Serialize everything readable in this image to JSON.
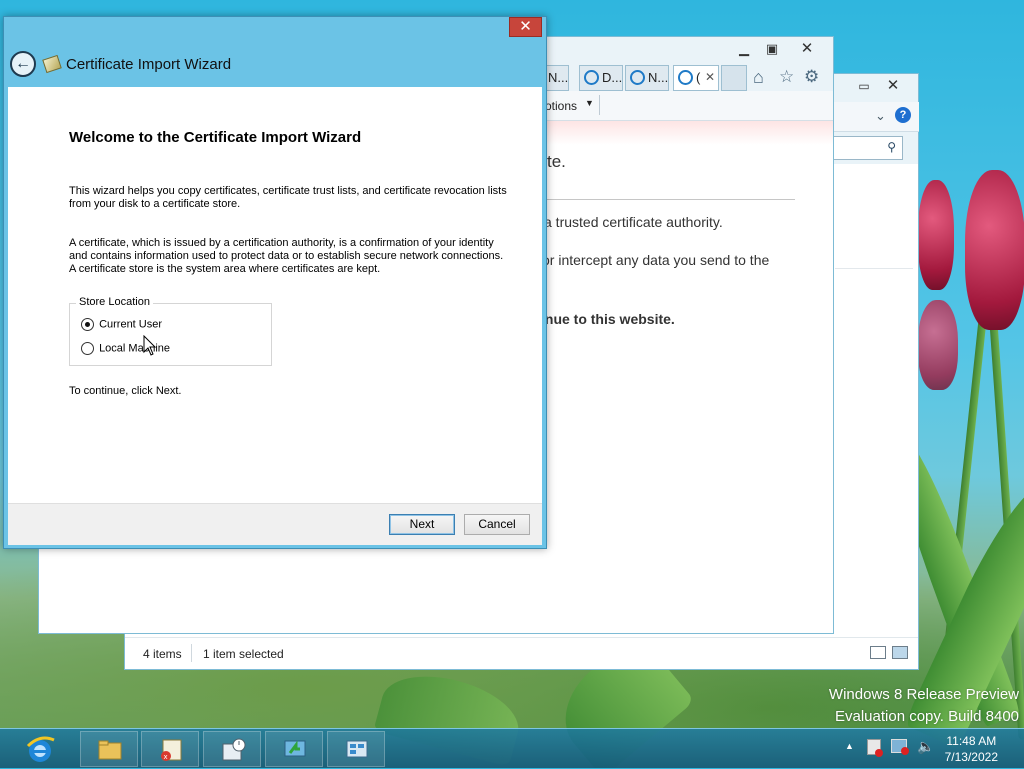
{
  "explorer": {
    "status_items": "4 items",
    "status_selected": "1 item selected"
  },
  "ie": {
    "tabs": [
      {
        "label": "N..."
      },
      {
        "label": "D..."
      },
      {
        "label": "N..."
      },
      {
        "label": "("
      }
    ],
    "active_tab_close": "✕",
    "tools_label": "otions",
    "page": {
      "line1": "te.",
      "line2": "a trusted certificate authority.",
      "line3": "or intercept any data you send to the",
      "line4": "inue to this website."
    }
  },
  "wizard": {
    "title": "Certificate Import Wizard",
    "close_label": "✕",
    "back_label": "←",
    "heading": "Welcome to the Certificate Import Wizard",
    "para1": "This wizard helps you copy certificates, certificate trust lists, and certificate revocation lists from your disk to a certificate store.",
    "para2": "A certificate, which is issued by a certification authority, is a confirmation of your identity and contains information used to protect data or to establish secure network connections. A certificate store is the system area where certificates are kept.",
    "store_location_label": "Store Location",
    "options": [
      {
        "label": "Current User",
        "selected": true
      },
      {
        "label": "Local Machine",
        "selected": false
      }
    ],
    "continue_text": "To continue, click Next.",
    "next_label": "Next",
    "cancel_label": "Cancel"
  },
  "watermark": {
    "line1": "Windows 8 Release Preview",
    "line2": "Evaluation copy. Build 8400"
  },
  "taskbar": {
    "apps": [
      "internet-explorer",
      "file-explorer",
      "certificate-manager",
      "task-scheduler",
      "server-manager-tool",
      "control-panel"
    ],
    "time": "11:48 AM",
    "date": "7/13/2022"
  },
  "colors": {
    "accent": "#6bc3e6",
    "close": "#c7453b",
    "taskbar": "#1c78a0"
  }
}
